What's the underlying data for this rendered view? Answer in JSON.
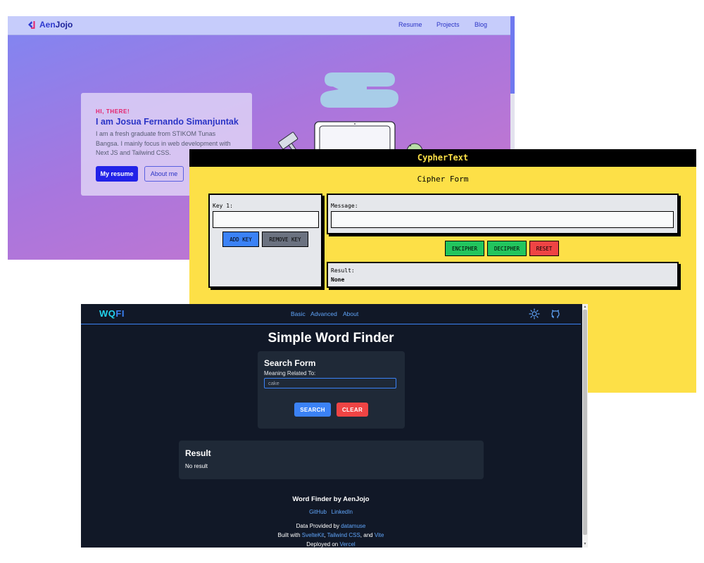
{
  "portfolio": {
    "logo": {
      "part1": "Aen",
      "part2": "Jojo"
    },
    "nav": [
      "Resume",
      "Projects",
      "Blog"
    ],
    "hero": {
      "eyebrow": "HI, THERE!",
      "name": "I am Josua Fernando Simanjuntak",
      "bio": "I am a fresh graduate from STIKOM Tunas Bangsa. I mainly focus in web development with Next JS and Tailwind CSS.",
      "primary_button": "My resume",
      "secondary_button": "About me"
    },
    "colors": {
      "brand": "#2222e8",
      "accent": "#e5216b"
    }
  },
  "cypher": {
    "app_title": "CypherText",
    "form_title": "Cipher Form",
    "key_label": "Key 1:",
    "key_value": "",
    "add_key_label": "ADD KEY",
    "remove_key_label": "REMOVE KEY",
    "message_label": "Message:",
    "message_value": "",
    "encipher_label": "ENCIPHER",
    "decipher_label": "DECIPHER",
    "reset_label": "RESET",
    "result_label": "Result:",
    "result_value": "None",
    "colors": {
      "background": "#fde047",
      "add": "#3b82f6",
      "remove": "#6b7280",
      "encipher": "#22c55e",
      "reset": "#ef4444"
    }
  },
  "wqfi": {
    "logo": {
      "w": "W",
      "q": "Q",
      "fi": "FI"
    },
    "nav": [
      "Basic",
      "Advanced",
      "About"
    ],
    "icons": [
      "sun-icon",
      "github-icon"
    ],
    "title": "Simple Word Finder",
    "search_form": {
      "title": "Search Form",
      "field_label": "Meaning Related To:",
      "field_value": "cake",
      "search_label": "SEARCH",
      "clear_label": "CLEAR"
    },
    "result": {
      "title": "Result",
      "text": "No result"
    },
    "footer": {
      "credit": "Word Finder by AenJojo",
      "links": [
        "GitHub",
        "LinkedIn"
      ],
      "data_prefix": "Data Provided by",
      "data_link": "datamuse",
      "built_prefix": "Built with",
      "built_links": [
        "SvelteKit",
        "Tailwind CSS",
        "Vite"
      ],
      "built_sep": ",",
      "built_and": ", and",
      "deployed_prefix": "Deployed on",
      "deployed_link": "Vercel"
    },
    "colors": {
      "background": "#111827",
      "card": "#1f2937",
      "search": "#3b82f6",
      "clear": "#ef4444"
    }
  }
}
